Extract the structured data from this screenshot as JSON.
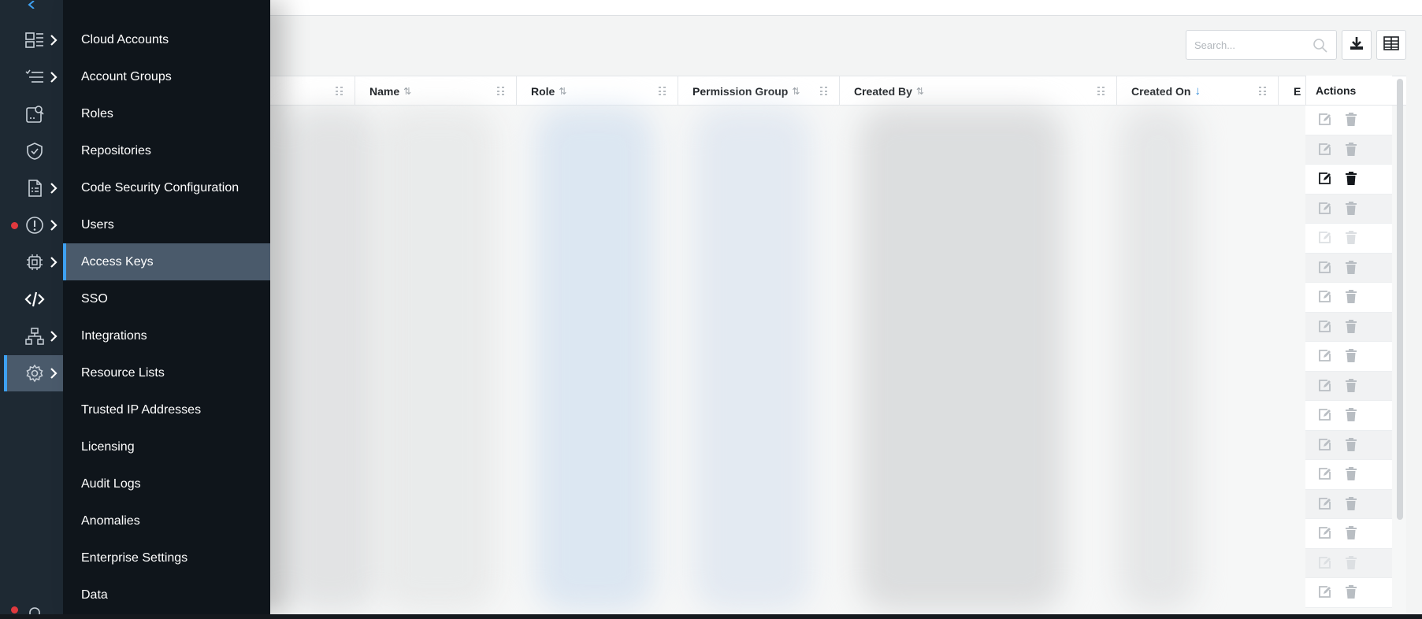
{
  "toolbar": {
    "search_placeholder": "Search...",
    "icons": {
      "search": "search-icon",
      "download": "download-icon",
      "columns": "columns-icon"
    }
  },
  "table": {
    "columns": [
      {
        "label": ""
      },
      {
        "label": "Name",
        "sort": "⇅"
      },
      {
        "label": "Role",
        "sort": "⇅"
      },
      {
        "label": "Permission Group",
        "sort": "⇅"
      },
      {
        "label": "Created By",
        "sort": "⇅"
      },
      {
        "label": "Created On",
        "sort": "↓"
      },
      {
        "label": "E"
      }
    ],
    "actions_header": "Actions",
    "action_rows": [
      {
        "state": "muted"
      },
      {
        "state": "muted"
      },
      {
        "state": "hover"
      },
      {
        "state": "muted"
      },
      {
        "state": "disabled"
      },
      {
        "state": "muted"
      },
      {
        "state": "muted"
      },
      {
        "state": "muted"
      },
      {
        "state": "muted"
      },
      {
        "state": "muted"
      },
      {
        "state": "muted"
      },
      {
        "state": "muted"
      },
      {
        "state": "muted"
      },
      {
        "state": "muted"
      },
      {
        "state": "muted"
      },
      {
        "state": "disabled"
      },
      {
        "state": "muted"
      }
    ]
  },
  "rail": {
    "items": [
      {
        "icon": "dashboard-icon",
        "has_chevron": true
      },
      {
        "icon": "list-check-icon",
        "has_chevron": true
      },
      {
        "icon": "investigate-icon",
        "has_chevron": false
      },
      {
        "icon": "shield-check-icon",
        "has_chevron": false
      },
      {
        "icon": "report-doc-icon",
        "has_chevron": true
      },
      {
        "icon": "alert-icon",
        "has_chevron": true,
        "dot": true
      },
      {
        "icon": "compute-chip-icon",
        "has_chevron": true
      },
      {
        "icon": "code-icon",
        "has_chevron": false
      },
      {
        "icon": "network-icon",
        "has_chevron": true
      },
      {
        "icon": "settings-gear-icon",
        "has_chevron": true,
        "active": true
      }
    ],
    "bottom": {
      "icon": "bell-icon",
      "dot": true
    }
  },
  "menu": {
    "items": [
      {
        "label": "Cloud Accounts"
      },
      {
        "label": "Account Groups"
      },
      {
        "label": "Roles"
      },
      {
        "label": "Repositories"
      },
      {
        "label": "Code Security Configuration"
      },
      {
        "label": "Users"
      },
      {
        "label": "Access Keys",
        "active": true
      },
      {
        "label": "SSO"
      },
      {
        "label": "Integrations"
      },
      {
        "label": "Resource Lists"
      },
      {
        "label": "Trusted IP Addresses"
      },
      {
        "label": "Licensing"
      },
      {
        "label": "Audit Logs"
      },
      {
        "label": "Anomalies"
      },
      {
        "label": "Enterprise Settings"
      },
      {
        "label": "Data"
      }
    ]
  },
  "colors": {
    "rail_bg": "#1e2933",
    "menu_bg": "#0f151b",
    "active_bg": "#4a5a6b",
    "accent": "#3ea1f2",
    "alert_dot": "#e0393e"
  }
}
